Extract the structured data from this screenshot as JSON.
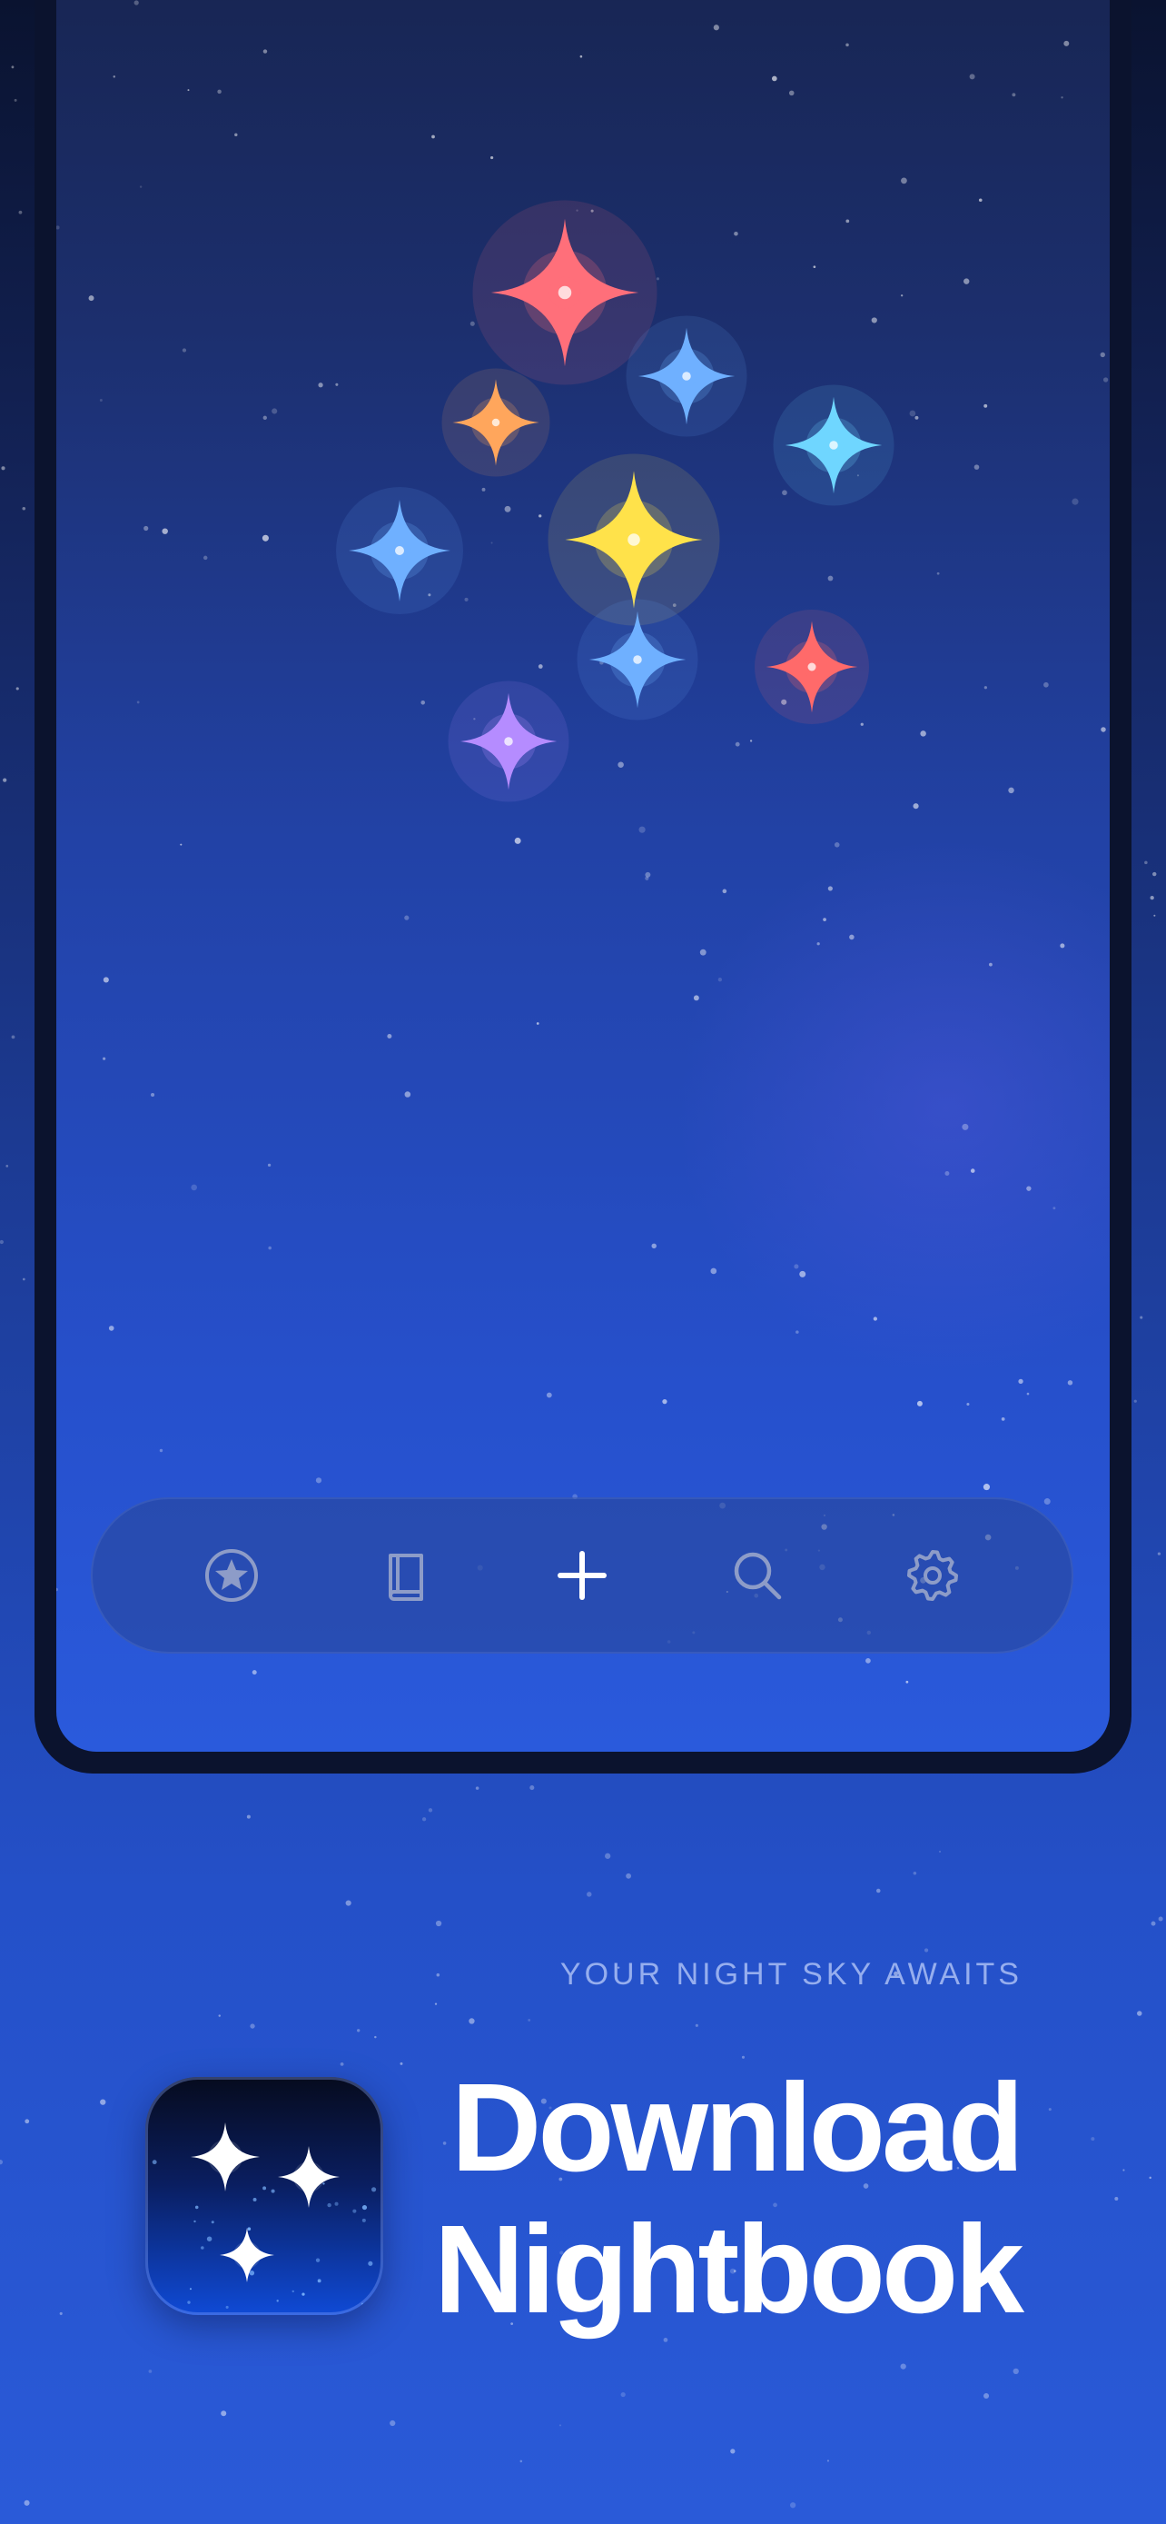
{
  "tab_bar": {
    "items": [
      {
        "id": "favorites",
        "icon": "star-circle-icon"
      },
      {
        "id": "journal",
        "icon": "book-icon"
      },
      {
        "id": "add",
        "icon": "plus-icon"
      },
      {
        "id": "search",
        "icon": "search-icon"
      },
      {
        "id": "settings",
        "icon": "gear-icon"
      }
    ]
  },
  "promo": {
    "tagline": "YOUR NIGHT SKY AWAITS",
    "headline_line1": "Download",
    "headline_line2": "Nightbook",
    "app_icon": "nightbook-app-icon"
  },
  "colors": {
    "star_pink": "#ff6f7a",
    "star_orange": "#ffa65c",
    "star_yellow": "#ffe24a",
    "star_blue": "#6fb0ff",
    "star_cyan": "#6fd6ff",
    "star_red": "#ff6a6a",
    "star_violet": "#b58cff",
    "tab_icon_inactive": "#8d9cc8",
    "tab_icon_active": "#ffffff"
  }
}
